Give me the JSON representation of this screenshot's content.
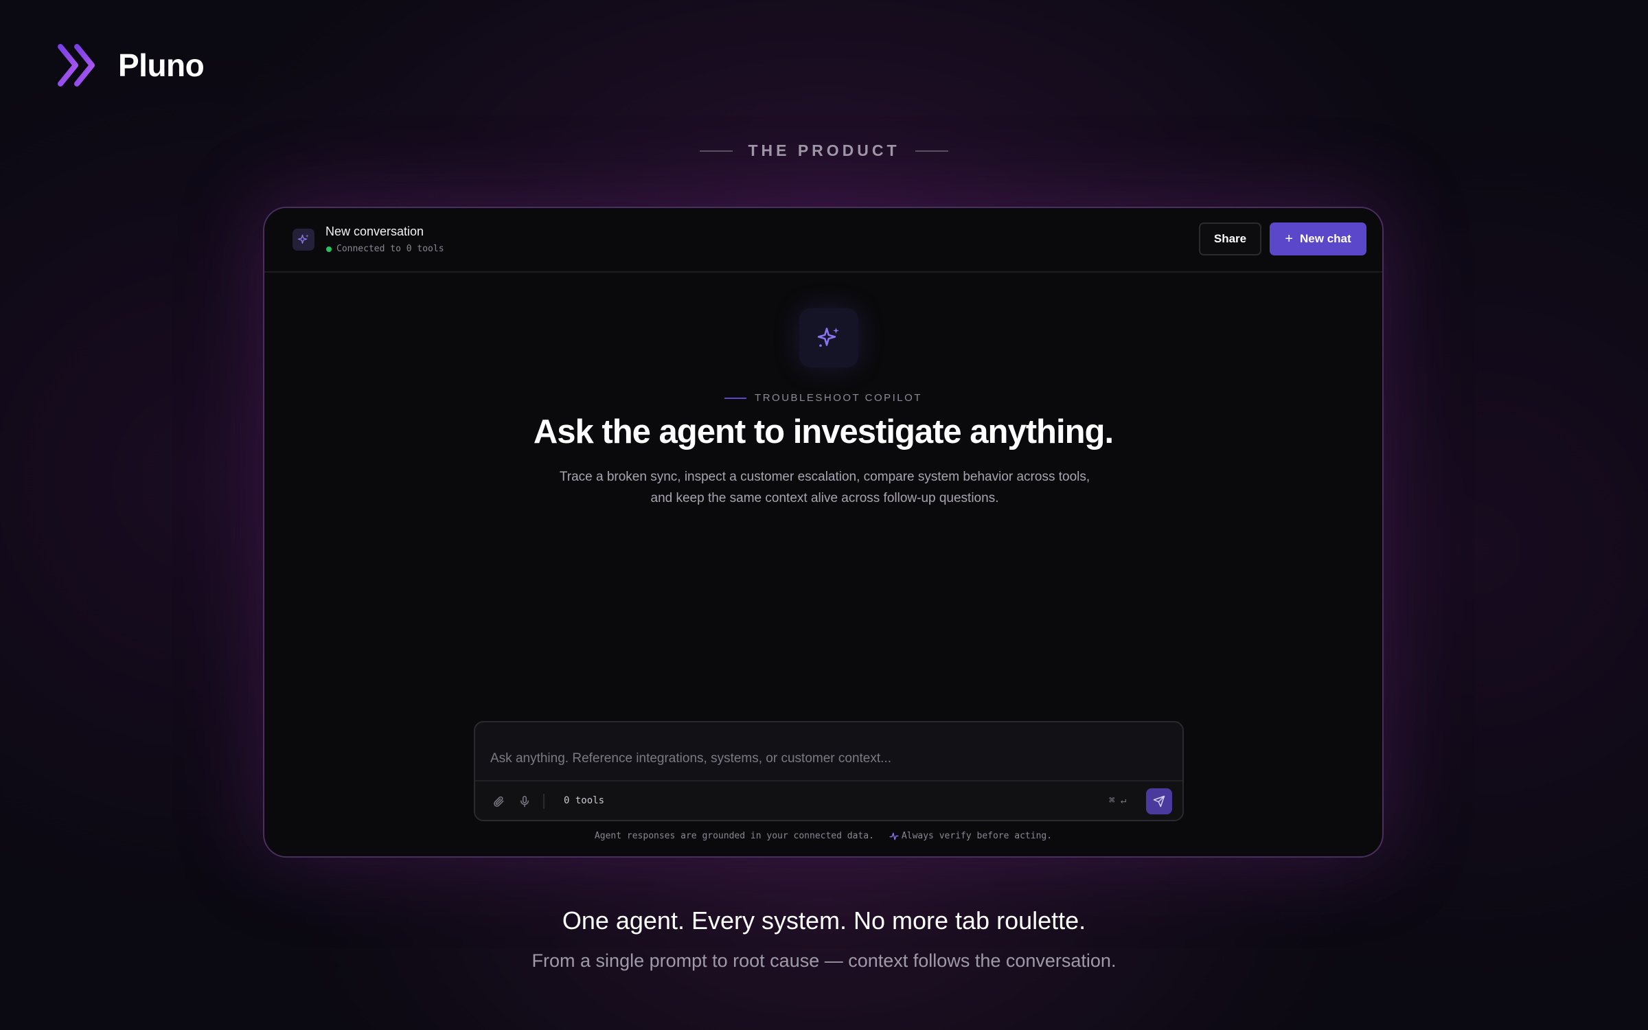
{
  "brand": {
    "name": "Pluno",
    "icon": "double-chevron-right-icon",
    "gradient": [
      "#7b3fe4",
      "#b05cf0"
    ]
  },
  "section": {
    "eyebrow": "THE PRODUCT"
  },
  "app": {
    "header": {
      "title": "New conversation",
      "status": "Connected to 0 tools",
      "status_color": "#22c55e",
      "share_label": "Share",
      "new_chat_label": "New chat",
      "new_chat_icon": "plus-icon"
    },
    "hero": {
      "icon": "sparkles-icon",
      "kicker": "TROUBLESHOOT COPILOT",
      "title": "Ask the agent to investigate anything.",
      "description": "Trace a broken sync, inspect a customer escalation, compare system behavior across tools, and keep the same context alive across follow-up questions."
    },
    "composer": {
      "placeholder": "Ask anything. Reference integrations, systems, or customer context...",
      "value": "",
      "tools_count": "0 tools",
      "shortcut": "⌘ ↵",
      "icons": [
        "paperclip-icon",
        "microphone-icon",
        "send-icon"
      ]
    },
    "disclaimer": {
      "main": "Agent responses are grounded in your connected data.",
      "verify": "Always verify before acting."
    },
    "accent_color": "#5b47c9"
  },
  "footer": {
    "tagline": "One agent. Every system. No more tab roulette.",
    "subtagline": "From a single prompt to root cause — context follows the conversation."
  }
}
